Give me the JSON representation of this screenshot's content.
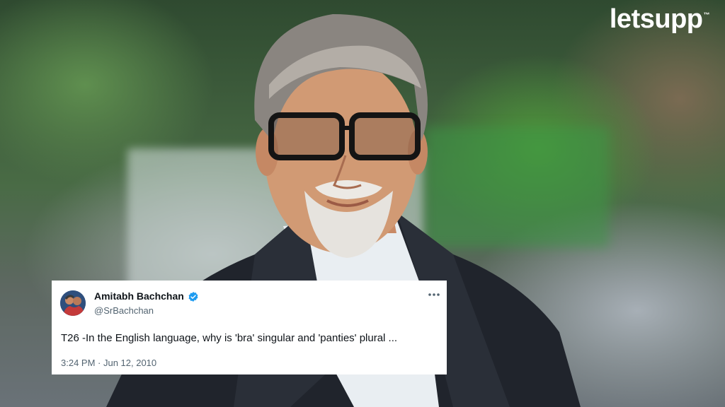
{
  "brand": {
    "logo_text": "letsupp",
    "logo_mark": "™"
  },
  "tweet": {
    "author_name": "Amitabh Bachchan",
    "author_handle": "@SrBachchan",
    "text": "T26 -In the English language, why is 'bra' singular and 'panties' plural ...",
    "timestamp": "3:24 PM · Jun 12, 2010",
    "verified_icon": "verified-badge-icon",
    "more_icon": "more-options-icon",
    "verified_color": "#1d9bf0"
  },
  "colors": {
    "card_bg": "#ffffff",
    "text": "#0f1419",
    "muted": "#536471"
  }
}
